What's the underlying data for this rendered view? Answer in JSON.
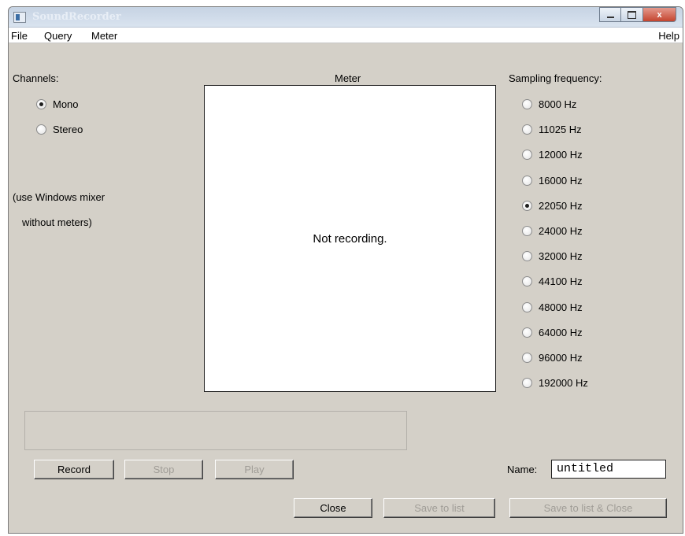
{
  "window": {
    "title": "SoundRecorder",
    "caption_buttons": {
      "minimize": "",
      "maximize": "",
      "close": "x"
    }
  },
  "menubar": {
    "items": [
      "File",
      "Query",
      "Meter"
    ],
    "help": "Help"
  },
  "channels": {
    "label": "Channels:",
    "options": [
      {
        "label": "Mono",
        "selected": true
      },
      {
        "label": "Stereo",
        "selected": false
      }
    ],
    "note_line1": "(use Windows mixer",
    "note_line2": "without meters)"
  },
  "meter": {
    "label": "Meter",
    "status": "Not recording."
  },
  "sampling": {
    "label": "Sampling frequency:",
    "options": [
      {
        "label": "8000 Hz",
        "selected": false
      },
      {
        "label": "11025 Hz",
        "selected": false
      },
      {
        "label": "12000 Hz",
        "selected": false
      },
      {
        "label": "16000 Hz",
        "selected": false
      },
      {
        "label": "22050 Hz",
        "selected": true
      },
      {
        "label": "24000 Hz",
        "selected": false
      },
      {
        "label": "32000 Hz",
        "selected": false
      },
      {
        "label": "44100 Hz",
        "selected": false
      },
      {
        "label": "48000 Hz",
        "selected": false
      },
      {
        "label": "64000 Hz",
        "selected": false
      },
      {
        "label": "96000 Hz",
        "selected": false
      },
      {
        "label": "192000 Hz",
        "selected": false
      }
    ]
  },
  "controls": {
    "record": "Record",
    "stop": "Stop",
    "play": "Play",
    "name_label": "Name:",
    "name_value": "untitled",
    "close": "Close",
    "save_to_list": "Save to list",
    "save_to_list_close": "Save to list & Close"
  }
}
